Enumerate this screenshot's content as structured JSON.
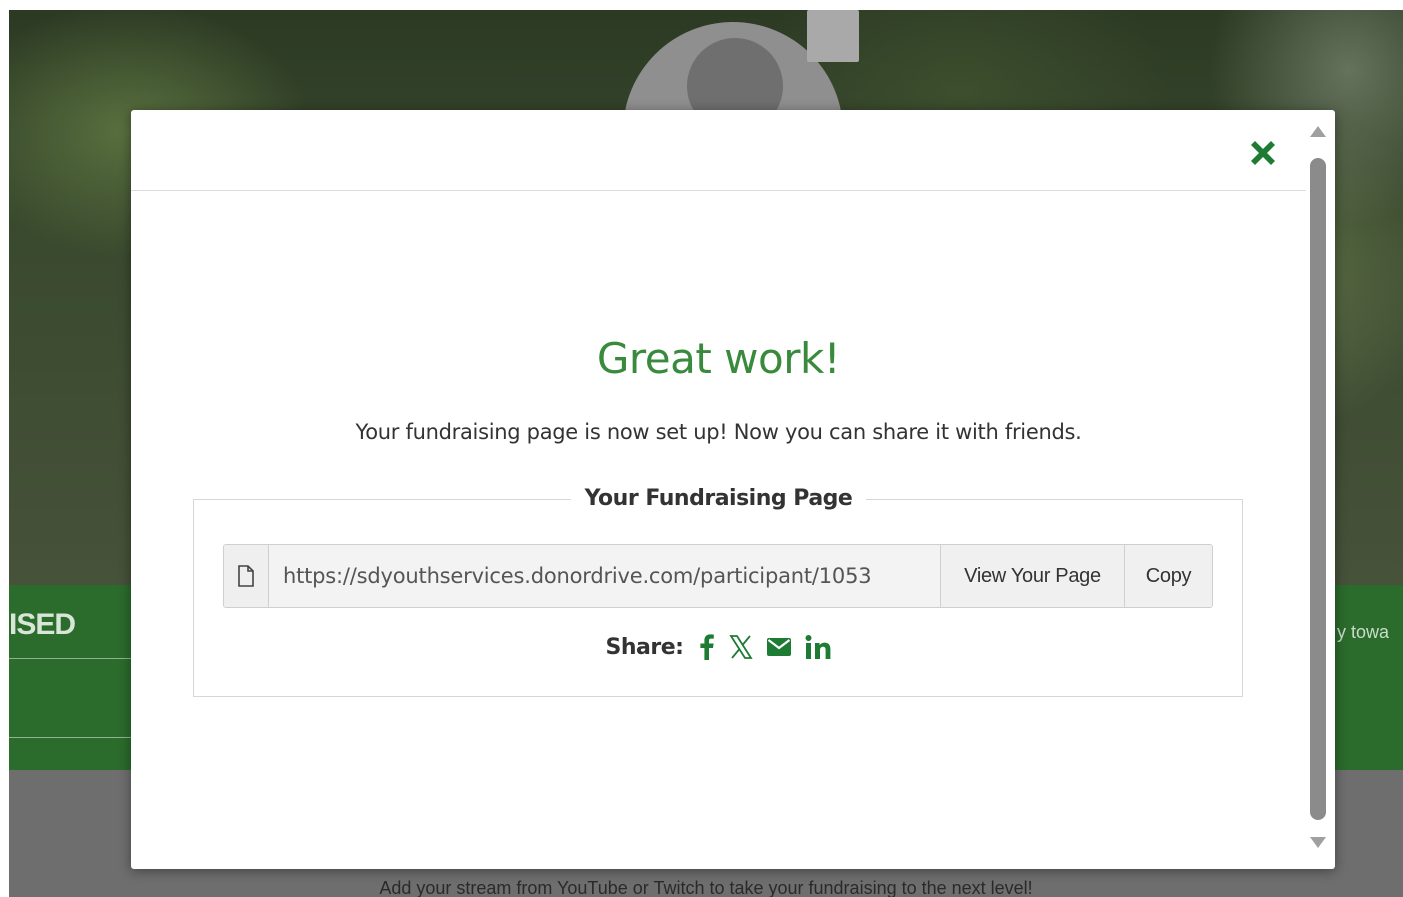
{
  "background": {
    "raised_label": "ISED",
    "right_fragment": "y towa",
    "stream_text": "Add your stream from YouTube or Twitch to take your fundraising to the next level!"
  },
  "modal": {
    "heading": "Great work!",
    "subtext": "Your fundraising page is now set up! Now you can share it with friends.",
    "section_title": "Your Fundraising Page",
    "page_url": "https://sdyouthservices.donordrive.com/participant/1053",
    "view_button": "View Your Page",
    "copy_button": "Copy",
    "share_label": "Share:",
    "share_icons": [
      "facebook-icon",
      "x-icon",
      "email-icon",
      "linkedin-icon"
    ],
    "close_icon": "close-icon"
  },
  "colors": {
    "accent_green": "#3a8a3e",
    "icon_green": "#1e7b34",
    "band_green": "#2b6b2c"
  }
}
